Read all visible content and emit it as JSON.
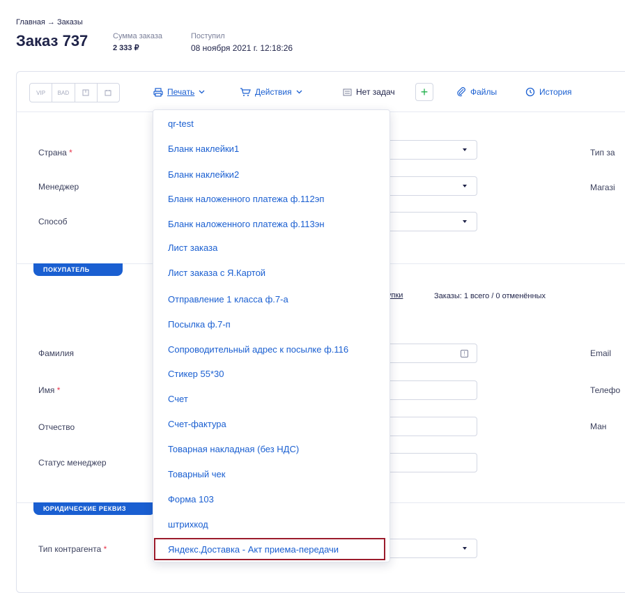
{
  "breadcrumb": "Главная → Заказы",
  "order": {
    "title": "Заказ 737",
    "sum_label": "Сумма заказа",
    "sum_value": "2 333 ₽",
    "received_label": "Поступил",
    "received_value": "08 ноября 2021 г. 12:18:26"
  },
  "toolbar": {
    "tags": [
      "VIP",
      "BAD",
      "",
      ""
    ],
    "print_label": "Печать",
    "actions_label": "Действия",
    "tasks_label": "Нет задач",
    "plus_label": "+",
    "files_label": "Файлы",
    "history_label": "История"
  },
  "form": {
    "country_label": "Страна",
    "manager_label": "Менеджер",
    "method_label": "Способ",
    "order_type_label": "Тип за",
    "shop_label": "Магазі",
    "buyer_section": "ПОКУПАТЕЛЬ",
    "purchases_link": "упки",
    "orders_info": "Заказы: 1 всего / 0 отменённых",
    "surname_label": "Фамилия",
    "name_label": "Имя",
    "patronymic_label": "Отчество",
    "status_manager_label": "Статус менеджер",
    "email_label": "Email",
    "phone_label": "Телефо",
    "man_label": "Ман",
    "legal_section": "ЮРИДИЧЕСКИЕ РЕКВИЗ",
    "contractor_type_label": "Тип контрагента",
    "required_mark": "*"
  },
  "print_menu": {
    "items": [
      "qr-test",
      "Бланк наклейки1",
      "Бланк наклейки2",
      "Бланк наложенного платежа ф.112эп",
      "Бланк наложенного платежа ф.113эн",
      "Лист заказа",
      "Лист заказа с Я.Картой",
      "Отправление 1 класса ф.7-а",
      "Посылка ф.7-п",
      "Сопроводительный адрес к посылке ф.116",
      "Стикер 55*30",
      "Счет",
      "Счет-фактура",
      "Товарная накладная (без НДС)",
      "Товарный чек",
      "Форма 103",
      "штрихкод",
      "Яндекс.Доставка - Акт приема-передачи"
    ],
    "highlighted_index": 17
  },
  "colors": {
    "link": "#1a5fd1",
    "section_tag": "#1a5fd1",
    "required": "#e8334a",
    "highlight_border": "#9b1b2c",
    "add_green": "#22b14c"
  }
}
